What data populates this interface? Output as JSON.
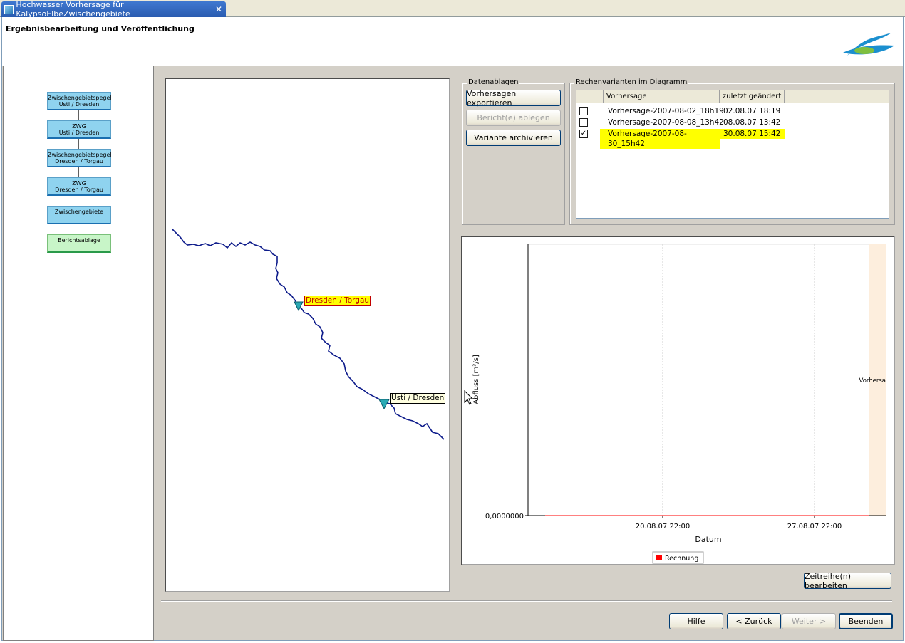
{
  "window": {
    "tab_title": "Hochwasser Vorhersage für KalypsoElbeZwischengebiete",
    "close_glyph": "✕"
  },
  "page": {
    "title": "Ergebnisbearbeitung und Veröffentlichung"
  },
  "flow": {
    "nodes": [
      {
        "line1": "Zwischengebietspegel",
        "line2": "Usti / Dresden"
      },
      {
        "line1": "ZWG",
        "line2": "Usti / Dresden"
      },
      {
        "line1": "Zwischengebietspegel",
        "line2": "Dresden / Torgau"
      },
      {
        "line1": "ZWG",
        "line2": "Dresden / Torgau"
      },
      {
        "line1": "Zwischengebiete",
        "line2": ""
      },
      {
        "line1": "Berichtsablage",
        "line2": ""
      }
    ]
  },
  "map": {
    "gauge_labels": [
      "Dresden / Torgau",
      "Usti / Dresden"
    ]
  },
  "datenablagen": {
    "label": "Datenablagen",
    "buttons": [
      "Vorhersagen exportieren",
      "Bericht(e) ablegen",
      "Variante archivieren"
    ]
  },
  "rechenvarianten": {
    "label": "Rechenvarianten im Diagramm",
    "columns": [
      "",
      "Vorhersage",
      "zuletzt geändert"
    ],
    "rows": [
      {
        "checked": false,
        "name": "Vorhersage-2007-08-02_18h19",
        "changed": "02.08.07 18:19"
      },
      {
        "checked": false,
        "name": "Vorhersage-2007-08-08_13h42",
        "changed": "08.08.07 13:42"
      },
      {
        "checked": true,
        "name": "Vorhersage-2007-08-30_15h42",
        "changed": "30.08.07 15:42"
      }
    ],
    "check_glyph": "✓"
  },
  "chart_data": {
    "type": "line",
    "xlabel": "Datum",
    "ylabel": "Abfluss [m³/s]",
    "x_ticks": [
      "20.08.07 22:00",
      "27.08.07 22:00"
    ],
    "y_ticks": [
      "0,0000000"
    ],
    "series": [
      {
        "name": "Rechnung",
        "values": [
          0,
          0
        ]
      }
    ],
    "region_label": "Vorhersa",
    "legend": "bottom-center",
    "grid": true,
    "colors": {
      "series": "#ff0000",
      "region": "#fdeedd"
    }
  },
  "buttons": {
    "zeitreihe": "Zeitreihe(n) bearbeiten",
    "hilfe": "Hilfe",
    "zurueck": "< Zurück",
    "weiter": "Weiter >",
    "beenden": "Beenden"
  }
}
